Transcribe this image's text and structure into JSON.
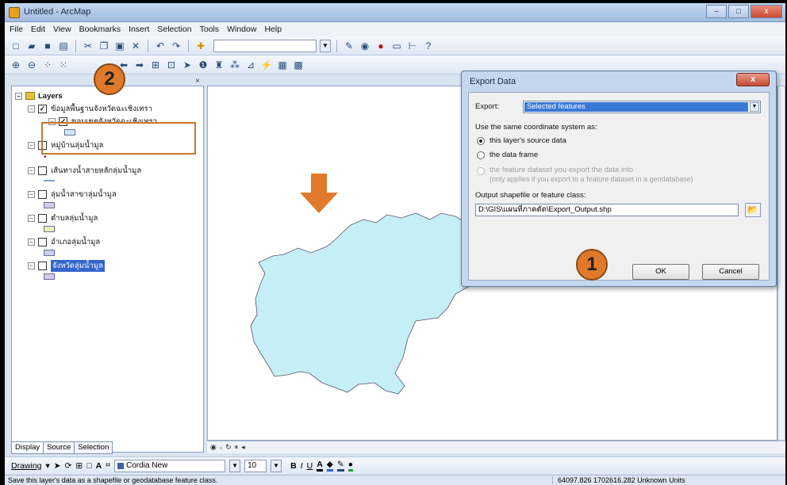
{
  "window": {
    "title": "Untitled - ArcMap",
    "min": "–",
    "max": "□",
    "close": "x"
  },
  "menu": [
    "File",
    "Edit",
    "View",
    "Bookmarks",
    "Insert",
    "Selection",
    "Tools",
    "Window",
    "Help"
  ],
  "toc": {
    "root": "Layers",
    "layers": [
      {
        "name": "ข้อมูลพื้นฐานจังหวัดฉะเชิงเทรา",
        "checked": true,
        "symbol_color": "#ffffff"
      },
      {
        "name": "ขอบเขตจังหวัดฉะเชิงเทรา",
        "checked": true,
        "symbol_color": "#c9ecf6"
      },
      {
        "name": "หมู่บ้านลุ่มน้ำมูล",
        "checked": false,
        "symbol_color": "#b4003a"
      },
      {
        "name": "เส้นทางน้ำสายหลักลุ่มน้ำมูล",
        "checked": false,
        "symbol_color": "#7aa0d6"
      },
      {
        "name": "ลุ่มน้ำสาขาลุ่มน้ำมูล",
        "checked": false,
        "symbol_color": "#d5cbe8"
      },
      {
        "name": "ตำบลลุ่มน้ำมูล",
        "checked": false,
        "symbol_color": "#eaf0b8"
      },
      {
        "name": "อำเภอลุ่มน้ำมูล",
        "checked": false,
        "symbol_color": "#cbd0ee"
      },
      {
        "name": "จังหวัดลุ่มน้ำมูล",
        "checked": false,
        "symbol_color": "#d8c8ec"
      }
    ],
    "tabs": [
      "Display",
      "Source",
      "Selection"
    ]
  },
  "drawing": {
    "label": "Drawing",
    "font": "Cordia New",
    "size": "10",
    "bold": "B",
    "italic": "I",
    "underline": "U"
  },
  "status": {
    "message": "Save this layer's data as a shapefile or geodatabase feature class.",
    "coords": "64097.826  1702616.282 Unknown Units"
  },
  "dialog": {
    "title": "Export Data",
    "export_label": "Export:",
    "export_value": "Selected features",
    "coord_label": "Use the same coordinate system as:",
    "option1": "this layer's source data",
    "option2": "the data frame",
    "option3_line1": "the feature dataset you export the data into",
    "option3_line2": "(only applies if you export to a feature dataset in a geodatabase)",
    "output_label": "Output shapefile or feature class:",
    "output_value": "D:\\GIS\\แผนที่ภาคตัด\\Export_Output.shp",
    "ok": "OK",
    "cancel": "Cancel"
  },
  "callouts": {
    "one": "1",
    "two": "2"
  },
  "colors": {
    "polygon_fill": "#c6eef6",
    "arrow": "#e07a2a",
    "callout": "#e07a2a"
  }
}
